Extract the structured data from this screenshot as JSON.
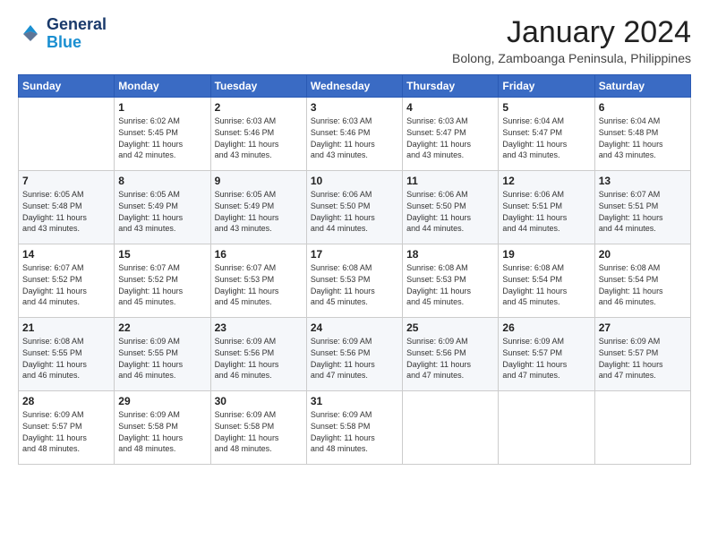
{
  "header": {
    "logo_line1": "General",
    "logo_line2": "Blue",
    "title": "January 2024",
    "location": "Bolong, Zamboanga Peninsula, Philippines"
  },
  "days_of_week": [
    "Sunday",
    "Monday",
    "Tuesday",
    "Wednesday",
    "Thursday",
    "Friday",
    "Saturday"
  ],
  "weeks": [
    [
      {
        "day": "",
        "info": ""
      },
      {
        "day": "1",
        "info": "Sunrise: 6:02 AM\nSunset: 5:45 PM\nDaylight: 11 hours\nand 42 minutes."
      },
      {
        "day": "2",
        "info": "Sunrise: 6:03 AM\nSunset: 5:46 PM\nDaylight: 11 hours\nand 43 minutes."
      },
      {
        "day": "3",
        "info": "Sunrise: 6:03 AM\nSunset: 5:46 PM\nDaylight: 11 hours\nand 43 minutes."
      },
      {
        "day": "4",
        "info": "Sunrise: 6:03 AM\nSunset: 5:47 PM\nDaylight: 11 hours\nand 43 minutes."
      },
      {
        "day": "5",
        "info": "Sunrise: 6:04 AM\nSunset: 5:47 PM\nDaylight: 11 hours\nand 43 minutes."
      },
      {
        "day": "6",
        "info": "Sunrise: 6:04 AM\nSunset: 5:48 PM\nDaylight: 11 hours\nand 43 minutes."
      }
    ],
    [
      {
        "day": "7",
        "info": "Sunrise: 6:05 AM\nSunset: 5:48 PM\nDaylight: 11 hours\nand 43 minutes."
      },
      {
        "day": "8",
        "info": "Sunrise: 6:05 AM\nSunset: 5:49 PM\nDaylight: 11 hours\nand 43 minutes."
      },
      {
        "day": "9",
        "info": "Sunrise: 6:05 AM\nSunset: 5:49 PM\nDaylight: 11 hours\nand 43 minutes."
      },
      {
        "day": "10",
        "info": "Sunrise: 6:06 AM\nSunset: 5:50 PM\nDaylight: 11 hours\nand 44 minutes."
      },
      {
        "day": "11",
        "info": "Sunrise: 6:06 AM\nSunset: 5:50 PM\nDaylight: 11 hours\nand 44 minutes."
      },
      {
        "day": "12",
        "info": "Sunrise: 6:06 AM\nSunset: 5:51 PM\nDaylight: 11 hours\nand 44 minutes."
      },
      {
        "day": "13",
        "info": "Sunrise: 6:07 AM\nSunset: 5:51 PM\nDaylight: 11 hours\nand 44 minutes."
      }
    ],
    [
      {
        "day": "14",
        "info": "Sunrise: 6:07 AM\nSunset: 5:52 PM\nDaylight: 11 hours\nand 44 minutes."
      },
      {
        "day": "15",
        "info": "Sunrise: 6:07 AM\nSunset: 5:52 PM\nDaylight: 11 hours\nand 45 minutes."
      },
      {
        "day": "16",
        "info": "Sunrise: 6:07 AM\nSunset: 5:53 PM\nDaylight: 11 hours\nand 45 minutes."
      },
      {
        "day": "17",
        "info": "Sunrise: 6:08 AM\nSunset: 5:53 PM\nDaylight: 11 hours\nand 45 minutes."
      },
      {
        "day": "18",
        "info": "Sunrise: 6:08 AM\nSunset: 5:53 PM\nDaylight: 11 hours\nand 45 minutes."
      },
      {
        "day": "19",
        "info": "Sunrise: 6:08 AM\nSunset: 5:54 PM\nDaylight: 11 hours\nand 45 minutes."
      },
      {
        "day": "20",
        "info": "Sunrise: 6:08 AM\nSunset: 5:54 PM\nDaylight: 11 hours\nand 46 minutes."
      }
    ],
    [
      {
        "day": "21",
        "info": "Sunrise: 6:08 AM\nSunset: 5:55 PM\nDaylight: 11 hours\nand 46 minutes."
      },
      {
        "day": "22",
        "info": "Sunrise: 6:09 AM\nSunset: 5:55 PM\nDaylight: 11 hours\nand 46 minutes."
      },
      {
        "day": "23",
        "info": "Sunrise: 6:09 AM\nSunset: 5:56 PM\nDaylight: 11 hours\nand 46 minutes."
      },
      {
        "day": "24",
        "info": "Sunrise: 6:09 AM\nSunset: 5:56 PM\nDaylight: 11 hours\nand 47 minutes."
      },
      {
        "day": "25",
        "info": "Sunrise: 6:09 AM\nSunset: 5:56 PM\nDaylight: 11 hours\nand 47 minutes."
      },
      {
        "day": "26",
        "info": "Sunrise: 6:09 AM\nSunset: 5:57 PM\nDaylight: 11 hours\nand 47 minutes."
      },
      {
        "day": "27",
        "info": "Sunrise: 6:09 AM\nSunset: 5:57 PM\nDaylight: 11 hours\nand 47 minutes."
      }
    ],
    [
      {
        "day": "28",
        "info": "Sunrise: 6:09 AM\nSunset: 5:57 PM\nDaylight: 11 hours\nand 48 minutes."
      },
      {
        "day": "29",
        "info": "Sunrise: 6:09 AM\nSunset: 5:58 PM\nDaylight: 11 hours\nand 48 minutes."
      },
      {
        "day": "30",
        "info": "Sunrise: 6:09 AM\nSunset: 5:58 PM\nDaylight: 11 hours\nand 48 minutes."
      },
      {
        "day": "31",
        "info": "Sunrise: 6:09 AM\nSunset: 5:58 PM\nDaylight: 11 hours\nand 48 minutes."
      },
      {
        "day": "",
        "info": ""
      },
      {
        "day": "",
        "info": ""
      },
      {
        "day": "",
        "info": ""
      }
    ]
  ]
}
